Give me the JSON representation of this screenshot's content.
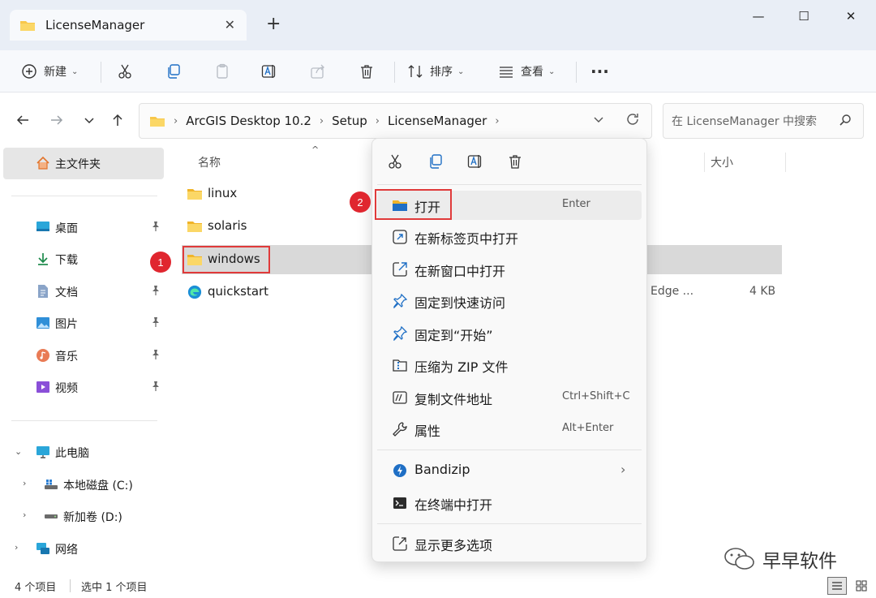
{
  "window": {
    "tab_title": "LicenseManager",
    "new_tab": "+",
    "minimize": "—",
    "maximize": "☐",
    "close": "✕"
  },
  "toolbar": {
    "new_label": "新建",
    "sort_label": "排序",
    "view_label": "查看",
    "more": "···"
  },
  "address": {
    "segments": [
      "ArcGIS Desktop 10.2",
      "Setup",
      "LicenseManager"
    ],
    "search_placeholder": "在 LicenseManager 中搜索"
  },
  "sidebar": {
    "home": "主文件夹",
    "quick": [
      {
        "label": "桌面",
        "icon": "desktop-icon",
        "pinned": true
      },
      {
        "label": "下载",
        "icon": "download-icon",
        "pinned": false
      },
      {
        "label": "文档",
        "icon": "document-icon",
        "pinned": true
      },
      {
        "label": "图片",
        "icon": "picture-icon",
        "pinned": true
      },
      {
        "label": "音乐",
        "icon": "music-icon",
        "pinned": true
      },
      {
        "label": "视频",
        "icon": "video-icon",
        "pinned": true
      }
    ],
    "this_pc": "此电脑",
    "drives": [
      "本地磁盘 (C:)",
      "新加卷 (D:)"
    ],
    "network": "网络"
  },
  "filelist": {
    "col_name": "名称",
    "col_size": "大小",
    "rows": [
      {
        "name": "linux",
        "type": "",
        "size": ""
      },
      {
        "name": "solaris",
        "type": "",
        "size": ""
      },
      {
        "name": "windows",
        "type": "",
        "size": ""
      },
      {
        "name": "quickstart",
        "type": "Edge ...",
        "size": "4 KB"
      }
    ]
  },
  "status": {
    "count": "4 个项目",
    "selected": "选中 1 个项目"
  },
  "context_menu": {
    "items": [
      {
        "label": "打开",
        "shortcut": "Enter",
        "icon": "folder-icon"
      },
      {
        "label": "在新标签页中打开",
        "shortcut": "",
        "icon": "new-tab-icon"
      },
      {
        "label": "在新窗口中打开",
        "shortcut": "",
        "icon": "new-window-icon"
      },
      {
        "label": "固定到快速访问",
        "shortcut": "",
        "icon": "pin-icon"
      },
      {
        "label": "固定到“开始”",
        "shortcut": "",
        "icon": "pin-start-icon"
      },
      {
        "label": "压缩为 ZIP 文件",
        "shortcut": "",
        "icon": "zip-icon"
      },
      {
        "label": "复制文件地址",
        "shortcut": "Ctrl+Shift+C",
        "icon": "copy-path-icon"
      },
      {
        "label": "属性",
        "shortcut": "Alt+Enter",
        "icon": "wrench-icon"
      }
    ],
    "bandizip": "Bandizip",
    "terminal": "在终端中打开",
    "more": "显示更多选项"
  },
  "badges": {
    "one": "1",
    "two": "2"
  },
  "watermark": "早早软件",
  "colors": {
    "accent": "#0067c0",
    "folder": "#f8c74a",
    "badge": "#e0262f",
    "highlight": "#d9d9d9"
  }
}
